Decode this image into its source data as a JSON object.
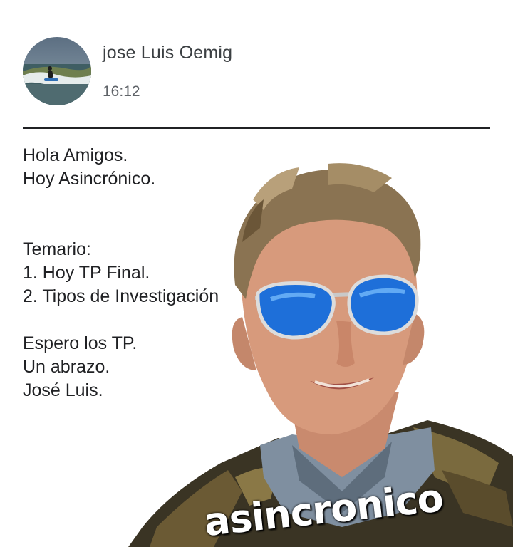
{
  "message": {
    "sender": "jose Luis Oemig",
    "time": "16:12",
    "avatar_icon": "surfer-avatar",
    "body_lines": [
      "Hola Amigos.",
      "Hoy Asincrónico.",
      "",
      "",
      "Temario:",
      "1. Hoy TP Final.",
      "2. Tipos de Investigación",
      "",
      "Espero los TP.",
      "Un abrazo.",
      "José Luis."
    ]
  },
  "sticker": {
    "caption": "asincronico",
    "icon": "man-with-sunglasses-sticker"
  },
  "colors": {
    "background": "#ffffff",
    "text": "#202124",
    "secondary_text": "#5f6368",
    "divider": "#202124",
    "sunglasses_lens": "#1e6fd9"
  }
}
